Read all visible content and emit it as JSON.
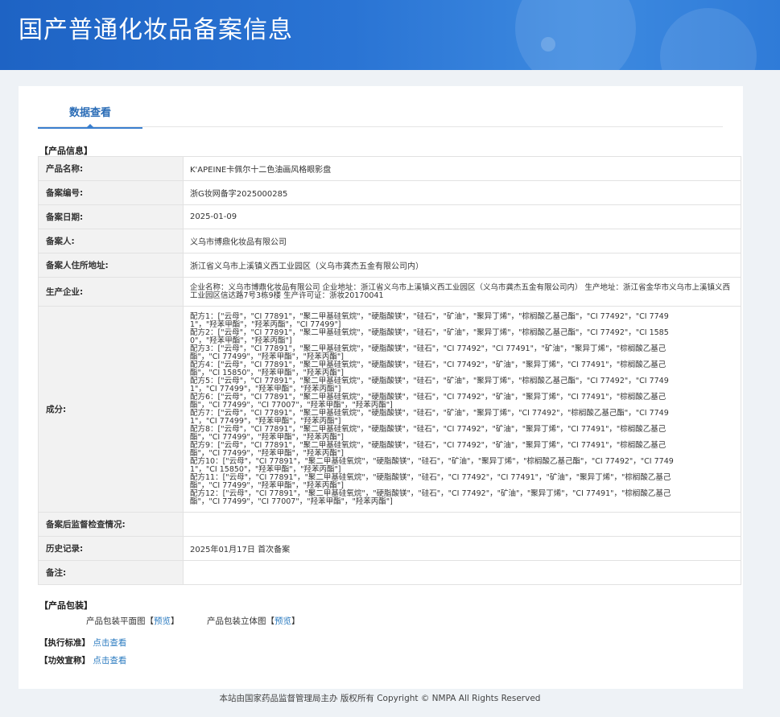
{
  "header": {
    "title": "国产普通化妆品备案信息"
  },
  "tab": {
    "label": "数据查看"
  },
  "sections": {
    "product_info": "【产品信息】",
    "packaging": "【产品包装】",
    "standard": "【执行标准】",
    "efficacy": "【功效宣称】"
  },
  "rows": {
    "product_name": {
      "label": "产品名称:",
      "value": "K'APEINE卡佩尔十二色油画风格眼影盘"
    },
    "record_no": {
      "label": "备案编号:",
      "value": "浙G妆网备字2025000285"
    },
    "record_date": {
      "label": "备案日期:",
      "value": "2025-01-09"
    },
    "registrant": {
      "label": "备案人:",
      "value": "义乌市博鼎化妆品有限公司"
    },
    "address": {
      "label": "备案人住所地址:",
      "value": "浙江省义乌市上溪镇义西工业园区（义乌市龚杰五金有限公司内）"
    },
    "manufacturer": {
      "label": "生产企业:",
      "value": "企业名称：义乌市博鼎化妆品有限公司 企业地址：浙江省义乌市上溪镇义西工业园区（义乌市龚杰五金有限公司内） 生产地址：浙江省金华市义乌市上溪镇义西工业园区信达路7号3栋9楼 生产许可证：浙妆20170041"
    },
    "ingredients": {
      "label": "成分:",
      "lines": [
        "配方1：[\"云母\"，\"CI 77891\"，\"聚二甲基硅氧烷\"，\"硬脂酸镁\"，\"硅石\"，\"矿油\"，\"聚异丁烯\"，\"棕榈酸乙基己酯\"，\"CI 77492\"，\"CI 77491\"，\"羟苯甲酯\"，\"羟苯丙酯\"，\"CI 77499\"]",
        "配方2：[\"云母\"，\"CI 77891\"，\"聚二甲基硅氧烷\"，\"硬脂酸镁\"，\"硅石\"，\"矿油\"，\"聚异丁烯\"，\"棕榈酸乙基己酯\"，\"CI 77492\"，\"CI 15850\"，\"羟苯甲酯\"，\"羟苯丙酯\"]",
        "配方3：[\"云母\"，\"CI 77891\"，\"聚二甲基硅氧烷\"，\"硬脂酸镁\"，\"硅石\"，\"CI 77492\"，\"CI 77491\"，\"矿油\"，\"聚异丁烯\"，\"棕榈酸乙基己酯\"，\"CI 77499\"，\"羟苯甲酯\"，\"羟苯丙酯\"]",
        "配方4：[\"云母\"，\"CI 77891\"，\"聚二甲基硅氧烷\"，\"硬脂酸镁\"，\"硅石\"，\"CI 77492\"，\"矿油\"，\"聚异丁烯\"，\"CI 77491\"，\"棕榈酸乙基己酯\"，\"CI 15850\"，\"羟苯甲酯\"，\"羟苯丙酯\"]",
        "配方5：[\"云母\"，\"CI 77891\"，\"聚二甲基硅氧烷\"，\"硬脂酸镁\"，\"硅石\"，\"矿油\"，\"聚异丁烯\"，\"棕榈酸乙基己酯\"，\"CI 77492\"，\"CI 77491\"，\"CI 77499\"，\"羟苯甲酯\"，\"羟苯丙酯\"]",
        "配方6：[\"云母\"，\"CI 77891\"，\"聚二甲基硅氧烷\"，\"硬脂酸镁\"，\"硅石\"，\"CI 77492\"，\"矿油\"，\"聚异丁烯\"，\"CI 77491\"，\"棕榈酸乙基己酯\"，\"CI 77499\"，\"CI 77007\"，\"羟苯甲酯\"，\"羟苯丙酯\"]",
        "配方7：[\"云母\"，\"CI 77891\"，\"聚二甲基硅氧烷\"，\"硬脂酸镁\"，\"硅石\"，\"矿油\"，\"聚异丁烯\"，\"CI 77492\"，\"棕榈酸乙基己酯\"，\"CI 77491\"，\"CI 77499\"，\"羟苯甲酯\"，\"羟苯丙酯\"]",
        "配方8：[\"云母\"，\"CI 77891\"，\"聚二甲基硅氧烷\"，\"硬脂酸镁\"，\"硅石\"，\"CI 77492\"，\"矿油\"，\"聚异丁烯\"，\"CI 77491\"，\"棕榈酸乙基己酯\"，\"CI 77499\"，\"羟苯甲酯\"，\"羟苯丙酯\"]",
        "配方9：[\"云母\"，\"CI 77891\"，\"聚二甲基硅氧烷\"，\"硬脂酸镁\"，\"硅石\"，\"CI 77492\"，\"矿油\"，\"聚异丁烯\"，\"CI 77491\"，\"棕榈酸乙基己酯\"，\"CI 77499\"，\"羟苯甲酯\"，\"羟苯丙酯\"]",
        "配方10：[\"云母\"，\"CI 77891\"，\"聚二甲基硅氧烷\"，\"硬脂酸镁\"，\"硅石\"，\"矿油\"，\"聚异丁烯\"，\"棕榈酸乙基己酯\"，\"CI 77492\"，\"CI 77491\"，\"CI 15850\"，\"羟苯甲酯\"，\"羟苯丙酯\"]",
        "配方11：[\"云母\"，\"CI 77891\"，\"聚二甲基硅氧烷\"，\"硬脂酸镁\"，\"硅石\"，\"CI 77492\"，\"CI 77491\"，\"矿油\"，\"聚异丁烯\"，\"棕榈酸乙基己酯\"，\"CI 77499\"，\"羟苯甲酯\"，\"羟苯丙酯\"]",
        "配方12：[\"云母\"，\"CI 77891\"，\"聚二甲基硅氧烷\"，\"硬脂酸镁\"，\"硅石\"，\"CI 77492\"，\"矿油\"，\"聚异丁烯\"，\"CI 77491\"，\"棕榈酸乙基己酯\"，\"CI 77499\"，\"CI 77007\"，\"羟苯甲酯\"，\"羟苯丙酯\"]"
      ]
    },
    "supervision": {
      "label": "备案后监督检查情况:",
      "value": ""
    },
    "history": {
      "label": "历史记录:",
      "value": "2025年01月17日 首次备案"
    },
    "remarks": {
      "label": "备注:",
      "value": ""
    }
  },
  "packaging": {
    "flat_label": "产品包装平面图",
    "flat_link": "预览",
    "solid_label": "产品包装立体图",
    "solid_link": "预览",
    "bracket_open": "【",
    "bracket_close": "】"
  },
  "links": {
    "standard": "点击查看",
    "efficacy": "点击查看"
  },
  "footer": {
    "text": "本站由国家药品监督管理局主办 版权所有 Copyright © NMPA All Rights Reserved"
  }
}
